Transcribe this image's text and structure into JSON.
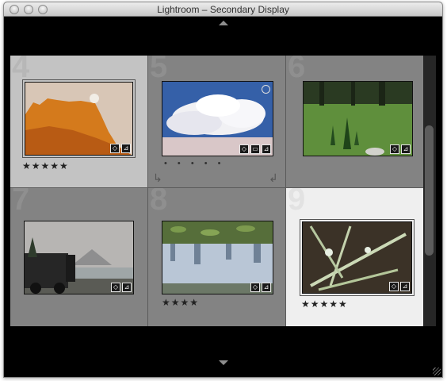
{
  "window": {
    "title": "Lightroom – Secondary Display"
  },
  "cells": [
    {
      "number": "4",
      "rating": "★★★★★",
      "badges": [
        "keyword-icon",
        "crop-icon"
      ]
    },
    {
      "number": "5",
      "rating": "• • • • •",
      "badges": [
        "keyword-icon",
        "stack-icon",
        "crop-icon"
      ]
    },
    {
      "number": "6",
      "rating": "",
      "badges": [
        "keyword-icon",
        "crop-icon"
      ]
    },
    {
      "number": "7",
      "rating": "",
      "badges": [
        "keyword-icon",
        "crop-icon"
      ]
    },
    {
      "number": "8",
      "rating": "★★★★",
      "badges": [
        "keyword-icon",
        "crop-icon"
      ]
    },
    {
      "number": "9",
      "rating": "★★★★★",
      "badges": [
        "keyword-icon",
        "crop-icon"
      ]
    }
  ],
  "icons": {
    "rotate_left": "rotate-left-icon",
    "rotate_right": "rotate-right-icon"
  },
  "colors": {
    "selected_cell": "#c3c3c3",
    "primary_cell": "#efefef",
    "cell": "#838383"
  }
}
